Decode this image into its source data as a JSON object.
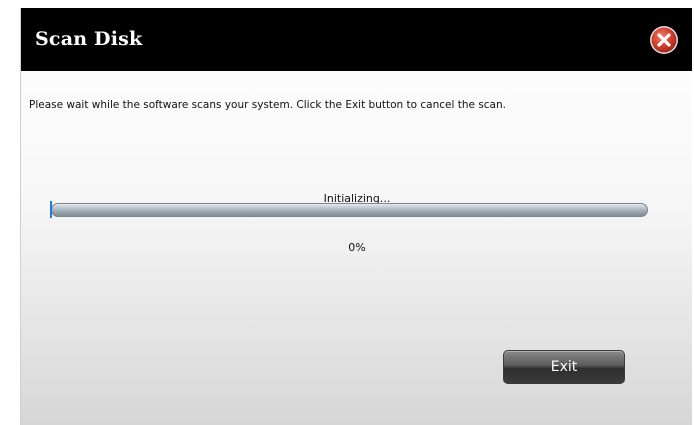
{
  "dialog": {
    "title": "Scan Disk",
    "close_icon": "close-x-circle-icon",
    "message": "Please wait while the software scans your system. Click the Exit button to cancel the scan.",
    "status": "Initializing...",
    "progress_percent": 0,
    "percent_label": "0%",
    "exit_label": "Exit"
  },
  "colors": {
    "titlebar": "#000000",
    "close_button": "#c0392b",
    "progress_fill": "#3d7fd6"
  }
}
